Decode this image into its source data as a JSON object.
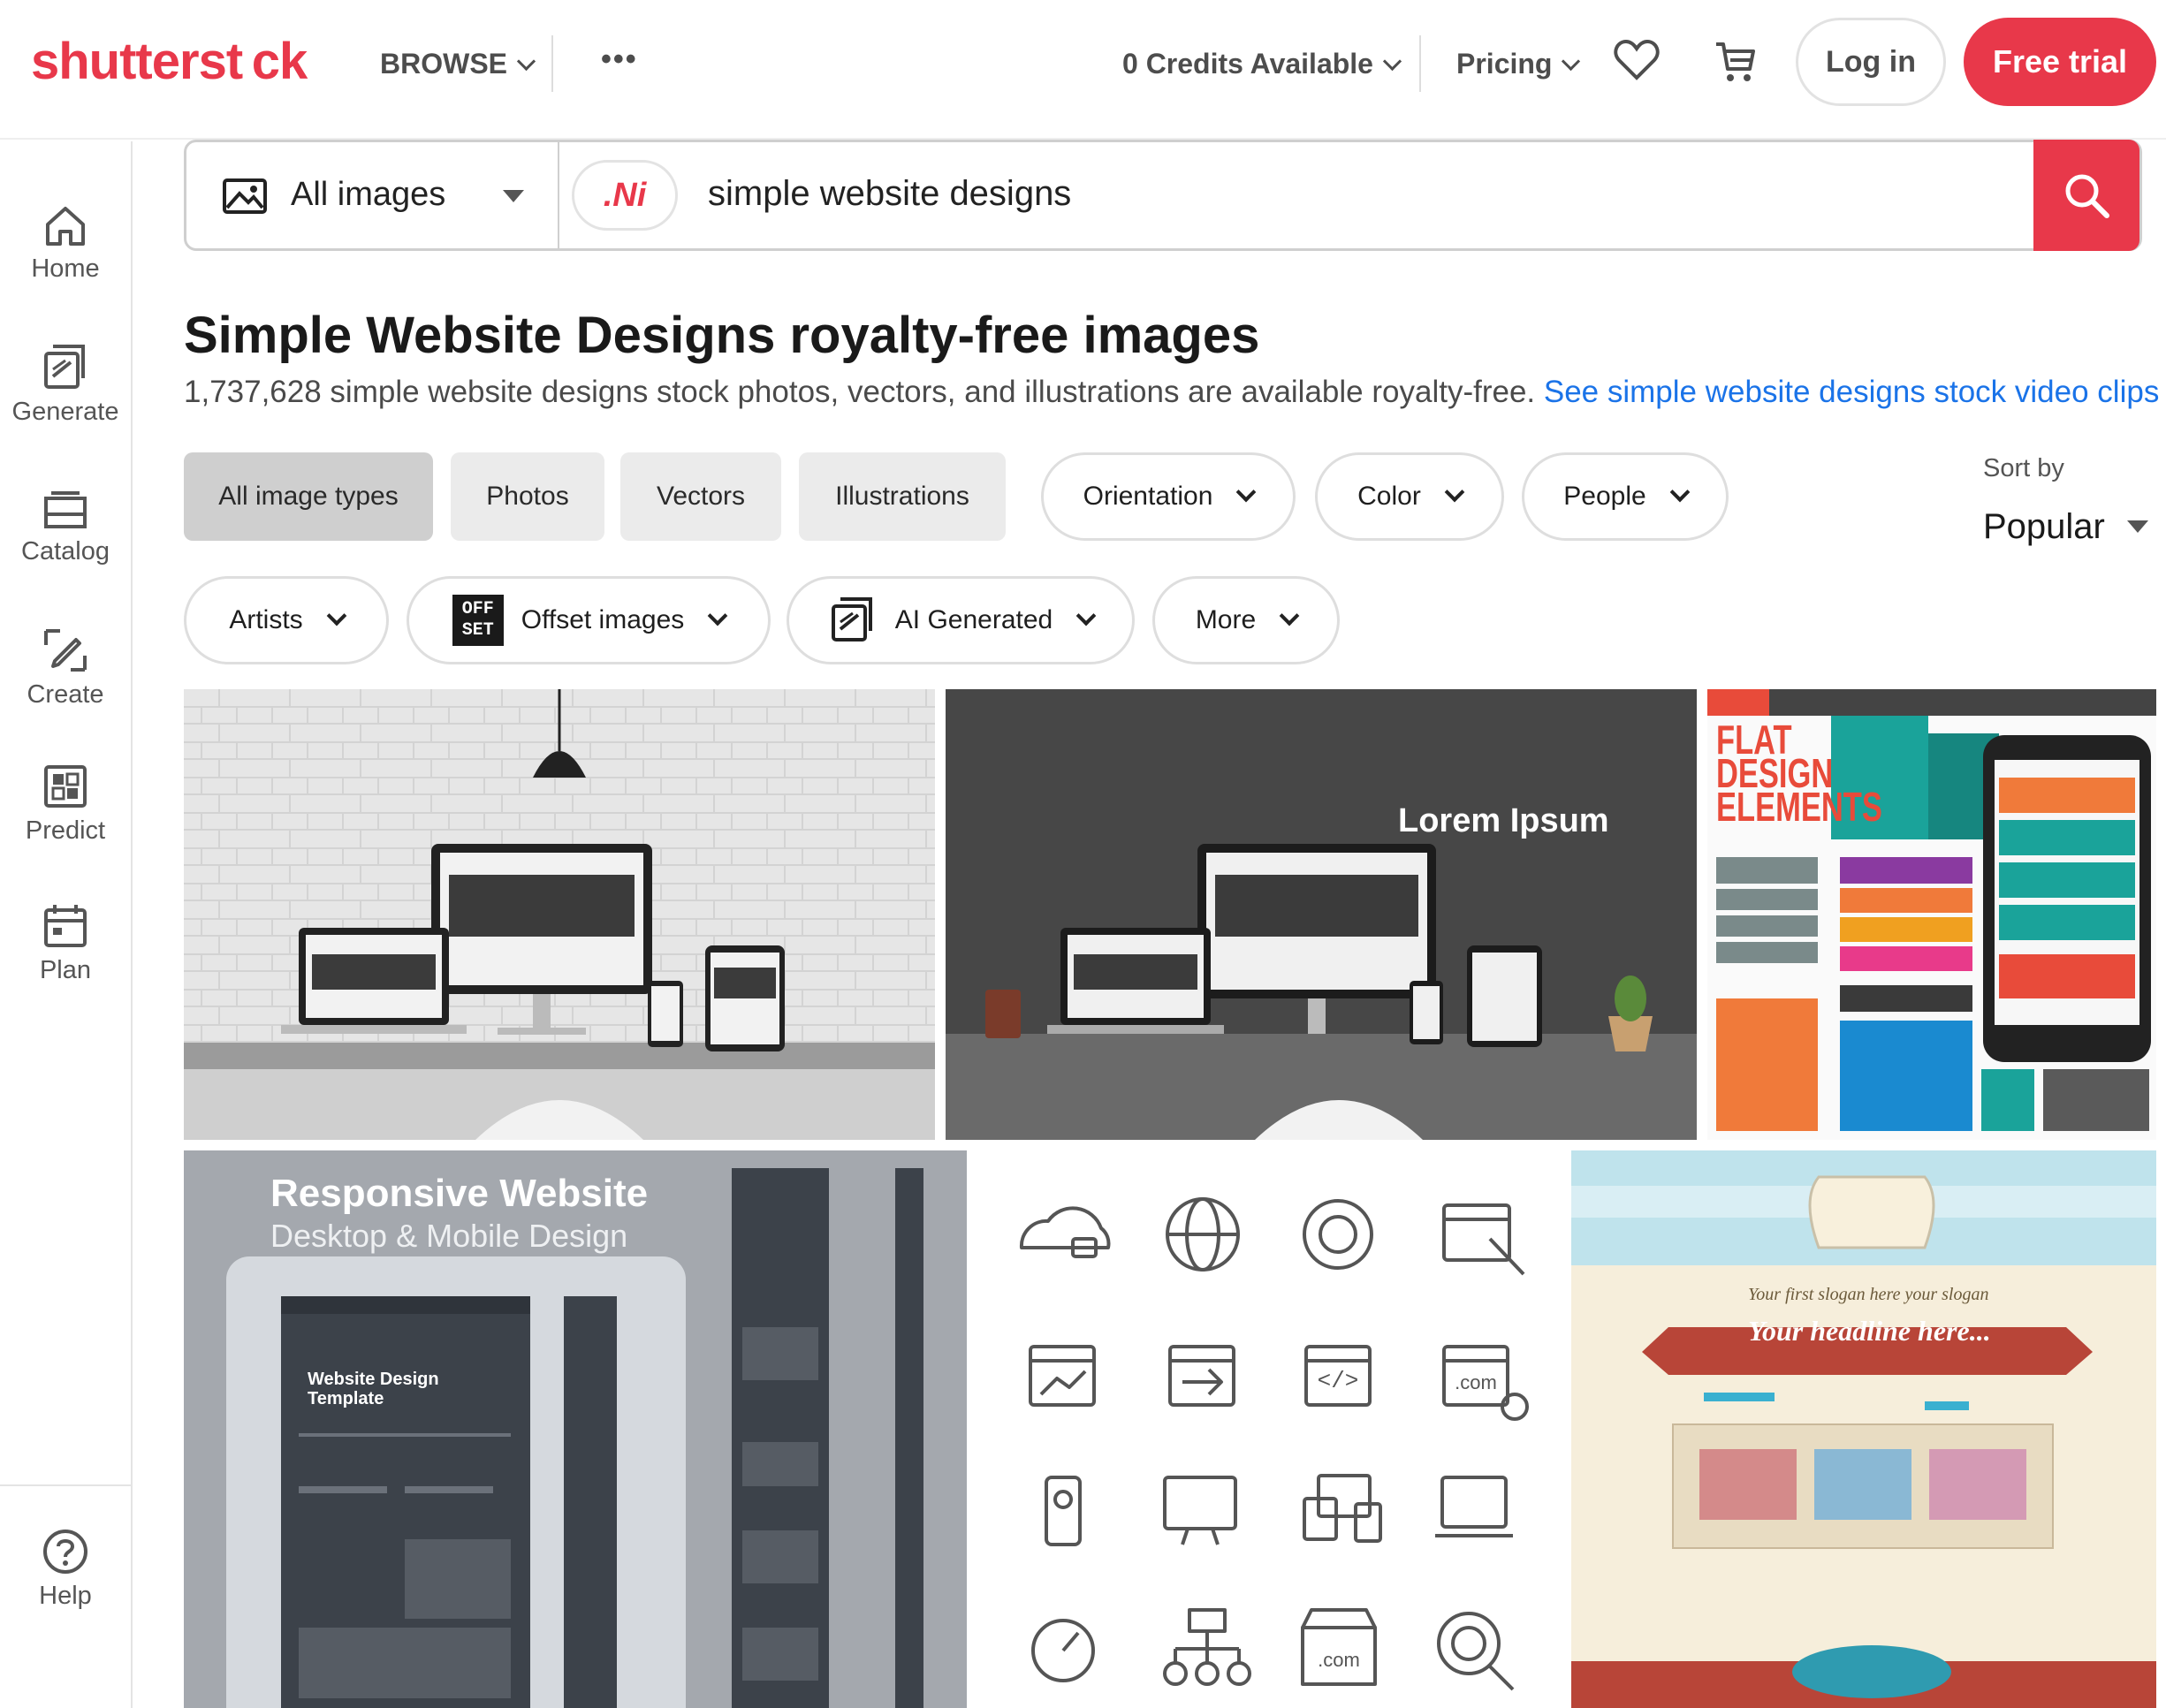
{
  "header": {
    "logo": "shutterst ck",
    "browse": "BROWSE",
    "more": "•••",
    "credits": "0 Credits Available",
    "pricing": "Pricing",
    "login": "Log in",
    "free_trial": "Free trial"
  },
  "sidebar": {
    "items": [
      {
        "label": "Home",
        "icon": "home-icon"
      },
      {
        "label": "Generate",
        "icon": "generate-icon"
      },
      {
        "label": "Catalog",
        "icon": "catalog-icon"
      },
      {
        "label": "Create",
        "icon": "create-icon"
      },
      {
        "label": "Predict",
        "icon": "predict-icon"
      },
      {
        "label": "Plan",
        "icon": "plan-icon"
      }
    ],
    "help": "Help"
  },
  "search": {
    "type": "All images",
    "query": "simple website designs",
    "ai_badge": ".Ni"
  },
  "main": {
    "title": "Simple Website Designs royalty-free images",
    "subtitle": "1,737,628 simple website designs stock photos, vectors, and illustrations are available royalty-free.",
    "video_link": "See simple website designs stock video clips",
    "type_chips": [
      "All image types",
      "Photos",
      "Vectors",
      "Illustrations"
    ],
    "filters_row1": [
      "Orientation",
      "Color",
      "People"
    ],
    "filters_row2": [
      "Artists",
      "Offset images",
      "AI Generated",
      "More"
    ],
    "offset_logo": "OFF SET",
    "sort_label": "Sort by",
    "sort_value": "Popular"
  },
  "images": {
    "img2_overlay": "Lorem Ipsum",
    "img3_title": [
      "FLAT",
      "DESIGN",
      "ELEMENTS"
    ],
    "img4_title": "Responsive Website",
    "img4_subtitle": "Desktop & Mobile Design",
    "img4_template": "Website Design Template",
    "img6_slogan": "Your first slogan here your slogan",
    "img6_headline": "Your headline here..."
  },
  "colors": {
    "brand": "#e8384a",
    "link": "#1a73e8"
  }
}
